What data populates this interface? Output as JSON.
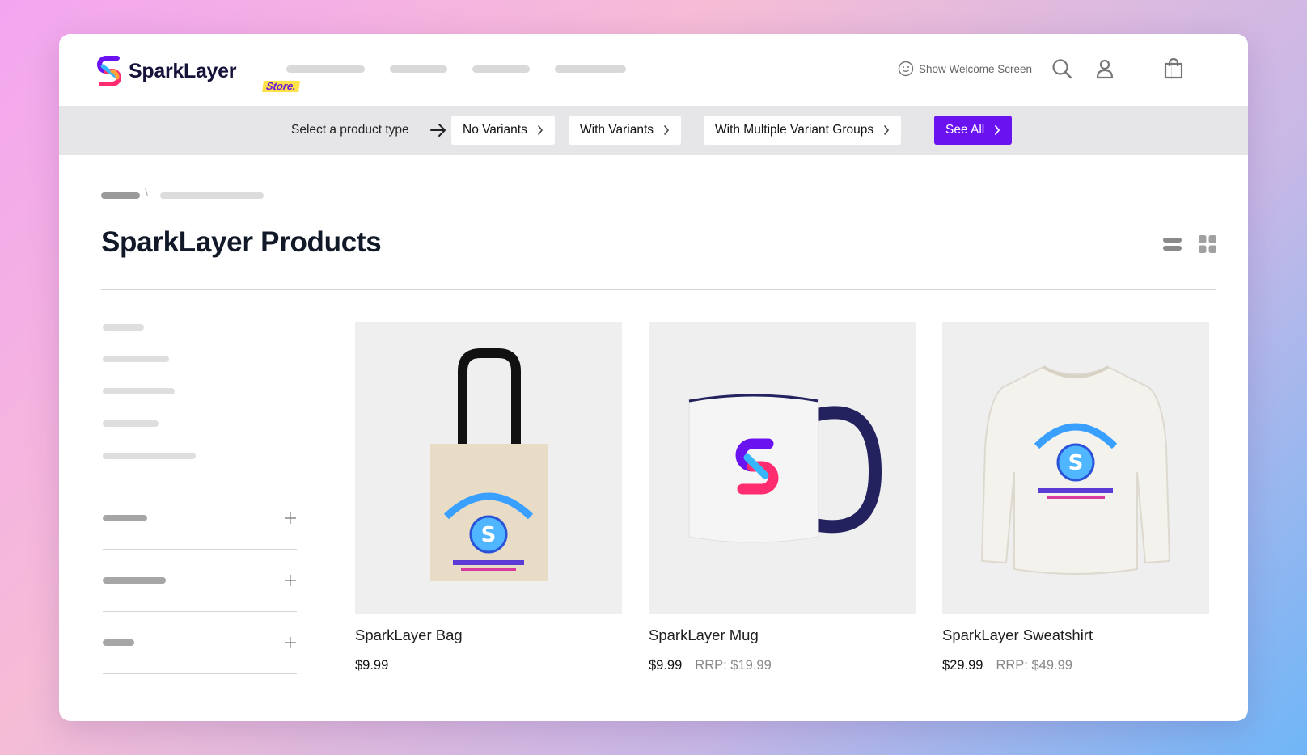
{
  "brand": {
    "name": "SparkLayer",
    "tag": "Store."
  },
  "header": {
    "welcome_label": "Show Welcome Screen"
  },
  "typebar": {
    "label": "Select a product type",
    "chips": [
      {
        "label": "No Variants"
      },
      {
        "label": "With Variants"
      },
      {
        "label": "With Multiple Variant Groups"
      },
      {
        "label": "See All"
      }
    ]
  },
  "page": {
    "title": "SparkLayer Products",
    "breadcrumb_separator": "\\"
  },
  "products": [
    {
      "name": "SparkLayer Bag",
      "price": "$9.99",
      "rrp": ""
    },
    {
      "name": "SparkLayer Mug",
      "price": "$9.99",
      "rrp": "RRP: $19.99"
    },
    {
      "name": "SparkLayer Sweatshirt",
      "price": "$29.99",
      "rrp": "RRP: $49.99"
    }
  ],
  "colors": {
    "accent": "#6a12f0",
    "title": "#111827",
    "bar": "#e6e6e8"
  }
}
